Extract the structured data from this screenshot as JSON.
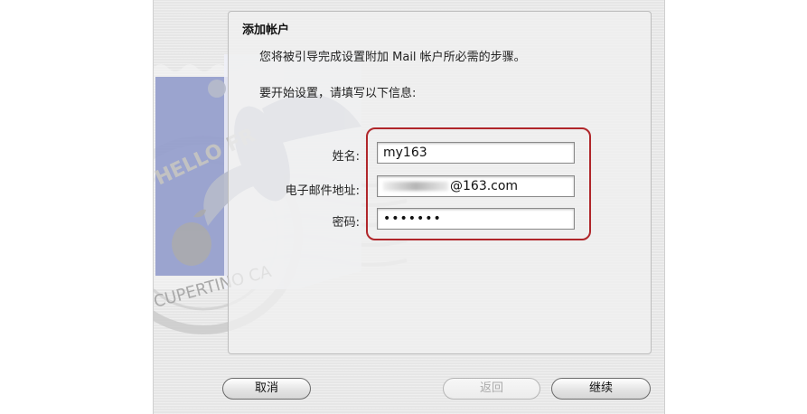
{
  "panel": {
    "title": "添加帐户",
    "description": "您将被引导完成设置附加 Mail 帐户所必需的步骤。",
    "prompt": "要开始设置，请填写以下信息:"
  },
  "form": {
    "name_label": "姓名:",
    "name_value": "my163",
    "email_label": "电子邮件地址:",
    "email_value_visible": "@163.com",
    "password_label": "密码:",
    "password_value": "•••••••"
  },
  "buttons": {
    "cancel": "取消",
    "back": "返回",
    "continue": "继续"
  },
  "stamp": {
    "text_top": "HELLO FR",
    "text_bottom": "CUPERTINO CA"
  },
  "colors": {
    "highlight": "#b0262a",
    "stamp_blue": "#8c97c9"
  }
}
